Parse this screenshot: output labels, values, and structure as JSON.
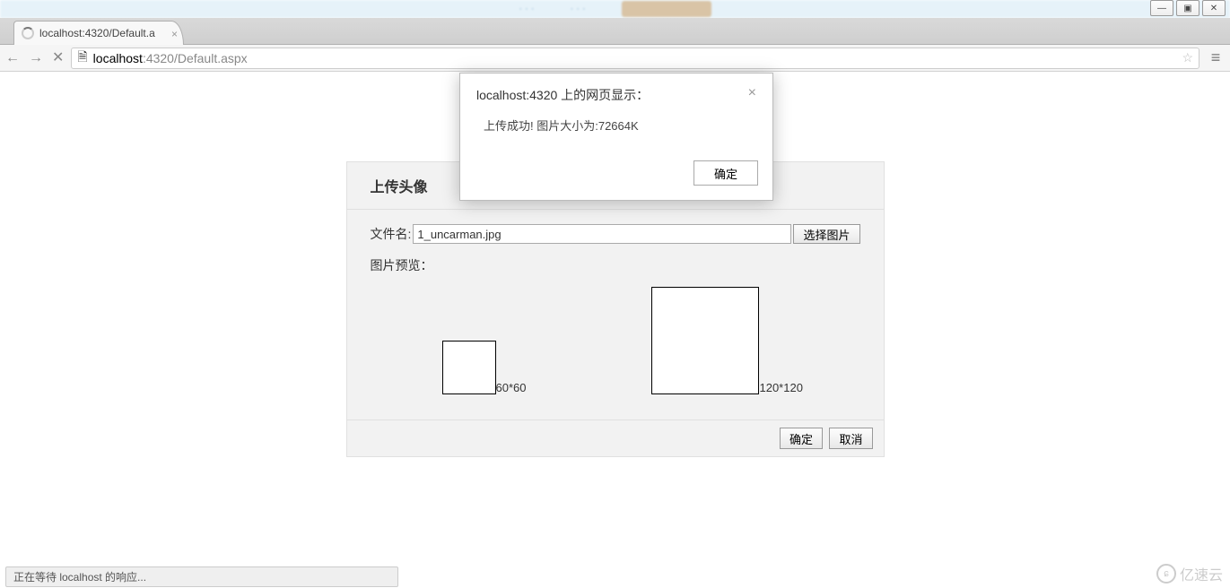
{
  "window": {
    "controls": {
      "min": "—",
      "max": "▣",
      "close": "✕"
    }
  },
  "tab": {
    "title": "localhost:4320/Default.a",
    "close": "×"
  },
  "nav": {
    "back": "←",
    "forward": "→",
    "reload": "✕",
    "page_icon": "🗎",
    "star": "☆",
    "menu": "≡"
  },
  "url": {
    "host_strong": "localhost",
    "host_dim": ":4320/Default.aspx"
  },
  "alert": {
    "title": "localhost:4320 上的网页显示：",
    "close": "×",
    "message": "上传成功! 图片大小为:72664K",
    "ok": "确定"
  },
  "panel": {
    "title": "上传头像",
    "file_label": "文件名:",
    "file_value": "1_uncarman.jpg",
    "select_btn": "选择图片",
    "preview_label": "图片预览：",
    "size60": "60*60",
    "size120": "120*120",
    "confirm": "确定",
    "cancel": "取消"
  },
  "status": {
    "text": "正在等待 localhost 的响应..."
  },
  "watermark": {
    "text": "亿速云",
    "icon": "ɕ"
  }
}
